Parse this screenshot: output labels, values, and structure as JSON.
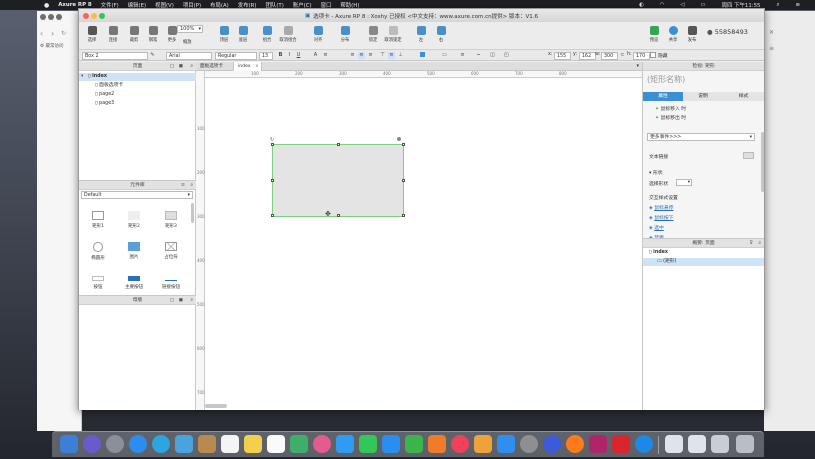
{
  "menubar": {
    "app_name": "Axure RP 8",
    "items": [
      "文件(F)",
      "编辑(E)",
      "视图(V)",
      "项目(P)",
      "布局(A)",
      "发布(R)",
      "团队(T)",
      "账户(C)",
      "窗口",
      "帮助(H)"
    ],
    "datetime": "周四 下午11:55"
  },
  "window": {
    "title": "选项卡 - Axure RP 8 : Xoshy 已授权    <中文支持：www.axure.com.cn提供> 版本：V1.6"
  },
  "browser": {
    "bookmarks_label": "最常访问"
  },
  "toolbar": {
    "left_buttons": [
      "选择",
      "连接",
      "裁剪",
      "钢笔",
      "更多"
    ],
    "zoom": "100%",
    "zoom_label": "缩放",
    "mid_buttons": [
      "顶层",
      "底层",
      "组合",
      "取消组合",
      "对齐",
      "分布",
      "锁定",
      "取消锁定",
      "左",
      "右"
    ],
    "right_buttons": [
      "预览",
      "共享",
      "发布"
    ],
    "user_id": "55858493"
  },
  "formatbar": {
    "style": "Box 2",
    "font": "Arial",
    "weight": "Regular",
    "size": "13",
    "x": "155",
    "y": "162",
    "w": "300",
    "h": "170",
    "x_label": "x:",
    "y_label": "y:",
    "w_label": "w:",
    "h_label": "h:",
    "hidden_label": "隐藏"
  },
  "pages_panel": {
    "title": "页面",
    "items": [
      "index",
      "面板选项卡",
      "page2",
      "page3"
    ]
  },
  "library_panel": {
    "title": "元件库",
    "selected_library": "Default",
    "widgets": [
      "矩形1",
      "矩形2",
      "矩形3",
      "椭圆形",
      "图片",
      "占位符",
      "按钮",
      "主要按钮",
      "链接按钮"
    ]
  },
  "masters_panel": {
    "title": "母版"
  },
  "tabs": [
    {
      "label": "面板选项卡"
    },
    {
      "label": "index"
    }
  ],
  "ruler_h_ticks": [
    "100",
    "200",
    "300",
    "400",
    "500",
    "600",
    "700",
    "800"
  ],
  "ruler_v_ticks": [
    "100",
    "200",
    "300",
    "400",
    "500",
    "600",
    "700"
  ],
  "inspector": {
    "header": "检视: 矩形",
    "name_placeholder": "(矩形名称)",
    "tabs": [
      "属性",
      "说明",
      "样式"
    ],
    "events": [
      "鼠标移入 时",
      "鼠标移出 时"
    ],
    "more_events": "更多事件>>>",
    "text_link": "文本链接",
    "shape_section": "形状",
    "select_shape": "选择形状",
    "interaction_styles": "交互样式设置",
    "style_links": [
      "鼠标悬停",
      "鼠标按下",
      "选中",
      "禁用"
    ]
  },
  "outline": {
    "title": "概要: 页面",
    "items": [
      "index",
      "(矩形)"
    ]
  },
  "colors": {
    "selection_border": "#7cd17a",
    "tab_active": "#3b8fd4",
    "link": "#2a6fb8"
  }
}
